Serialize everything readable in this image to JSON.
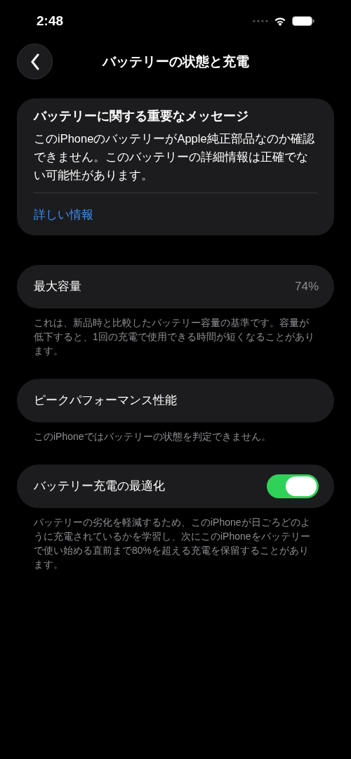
{
  "status_bar": {
    "time": "2:48"
  },
  "nav": {
    "title": "バッテリーの状態と充電"
  },
  "message": {
    "title": "バッテリーに関する重要なメッセージ",
    "body": "このiPhoneのバッテリーがApple純正部品なのか確認できません。このバッテリーの詳細情報は正確でない可能性があります。",
    "link": "詳しい情報"
  },
  "sections": [
    {
      "kind": "value",
      "label": "最大容量",
      "value": "74%",
      "footer": "これは、新品時と比較したバッテリー容量の基準です。容量が低下すると、1回の充電で使用できる時間が短くなることがあります。"
    },
    {
      "kind": "plain",
      "label": "ピークパフォーマンス性能",
      "footer": "このiPhoneではバッテリーの状態を判定できません。"
    },
    {
      "kind": "toggle",
      "label": "バッテリー充電の最適化",
      "on": true,
      "footer": "バッテリーの劣化を軽減するため、このiPhoneが日ごろどのように充電されているかを学習し、次にこのiPhoneをバッテリーで使い始める直前まで80%を超える充電を保留することがあります。"
    }
  ]
}
